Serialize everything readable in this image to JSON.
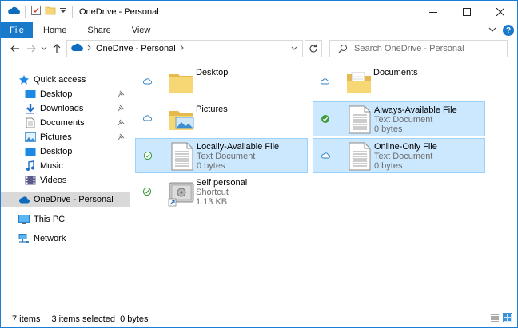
{
  "window": {
    "title": "OneDrive - Personal",
    "accent": "#1979ca"
  },
  "ribbon": {
    "file_label": "File",
    "tabs": [
      "Home",
      "Share",
      "View"
    ],
    "help_label": "?"
  },
  "address": {
    "location": "OneDrive - Personal",
    "search_placeholder": "Search OneDrive - Personal"
  },
  "sidebar": {
    "quick_access": "Quick access",
    "items": [
      {
        "label": "Desktop",
        "icon": "desktop-icon",
        "pinned": true
      },
      {
        "label": "Downloads",
        "icon": "downloads-icon",
        "pinned": true
      },
      {
        "label": "Documents",
        "icon": "documents-icon",
        "pinned": true
      },
      {
        "label": "Pictures",
        "icon": "pictures-icon",
        "pinned": true
      },
      {
        "label": "Desktop",
        "icon": "desktop-icon",
        "pinned": false
      },
      {
        "label": "Music",
        "icon": "music-icon",
        "pinned": false
      },
      {
        "label": "Videos",
        "icon": "videos-icon",
        "pinned": false
      }
    ],
    "onedrive": "OneDrive - Personal",
    "this_pc": "This PC",
    "network": "Network"
  },
  "files": [
    {
      "name": "Desktop",
      "type": "",
      "size": "",
      "status": "cloud",
      "kind": "folder",
      "selected": false
    },
    {
      "name": "Documents",
      "type": "",
      "size": "",
      "status": "cloud",
      "kind": "folder-doc",
      "selected": false
    },
    {
      "name": "Pictures",
      "type": "",
      "size": "",
      "status": "cloud",
      "kind": "folder-pic",
      "selected": false
    },
    {
      "name": "Always-Available File",
      "type": "Text Document",
      "size": "0 bytes",
      "status": "always-available",
      "kind": "text",
      "selected": true
    },
    {
      "name": "Locally-Available File",
      "type": "Text Document",
      "size": "0 bytes",
      "status": "local",
      "kind": "text",
      "selected": true
    },
    {
      "name": "Online-Only File",
      "type": "Text Document",
      "size": "0 bytes",
      "status": "cloud",
      "kind": "text",
      "selected": true
    },
    {
      "name": "Seif personal",
      "type": "Shortcut",
      "size": "1.13 KB",
      "status": "local",
      "kind": "shortcut",
      "selected": false
    }
  ],
  "statusbar": {
    "count": "7 items",
    "selection": "3 items selected  0 bytes"
  }
}
